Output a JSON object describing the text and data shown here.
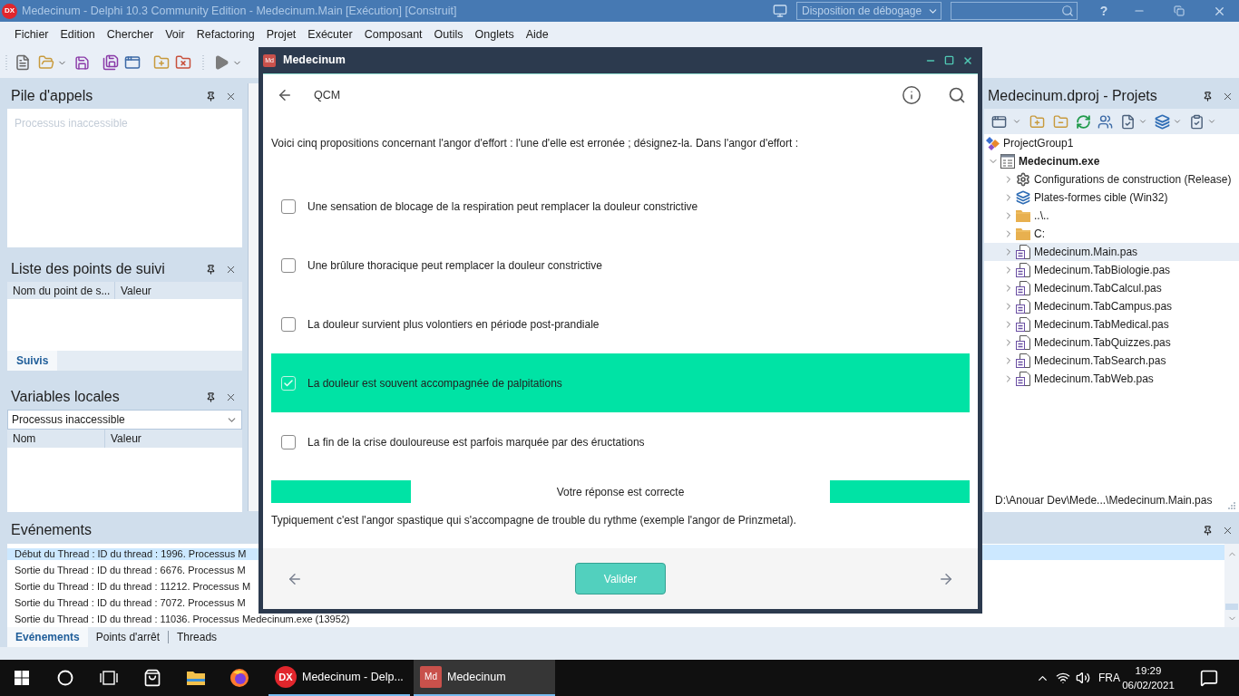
{
  "ide": {
    "logo": "DX",
    "title": "Medecinum - Delphi 10.3 Community Edition - Medecinum.Main [Exécution] [Construit]",
    "layout_dropdown": "Disposition de débogage",
    "help": "?",
    "menu": [
      "Fichier",
      "Edition",
      "Chercher",
      "Voir",
      "Refactoring",
      "Projet",
      "Exécuter",
      "Composant",
      "Outils",
      "Onglets",
      "Aide"
    ],
    "call_stack": {
      "title": "Pile d'appels",
      "message": "Processus inaccessible"
    },
    "watches": {
      "title": "Liste des points de suivi",
      "columns": [
        "Nom du point de s...",
        "Valeur"
      ],
      "tabs": [
        {
          "label": "Suivis",
          "selected": true
        }
      ]
    },
    "locals": {
      "title": "Variables locales",
      "dropdown": "Processus inaccessible",
      "columns": [
        "Nom",
        "Valeur"
      ]
    },
    "projects": {
      "title": "Medecinum.dproj - Projets",
      "tree": [
        {
          "label": "ProjectGroup1",
          "kind": "group",
          "selected": false,
          "children": [
            {
              "label": "Medecinum.exe",
              "kind": "project",
              "expanded": true,
              "selected": false,
              "children": [
                {
                  "label": "Configurations de construction (Release)",
                  "kind": "config",
                  "expanded": false,
                  "selected": false
                },
                {
                  "label": "Plates-formes cible (Win32)",
                  "kind": "platforms",
                  "expanded": false,
                  "selected": false
                },
                {
                  "label": "..\\..",
                  "kind": "folder",
                  "expanded": false,
                  "selected": false
                },
                {
                  "label": "C:",
                  "kind": "folder",
                  "expanded": false,
                  "selected": false
                },
                {
                  "label": "Medecinum.Main.pas",
                  "kind": "unit",
                  "expanded": false,
                  "selected": true
                },
                {
                  "label": "Medecinum.TabBiologie.pas",
                  "kind": "unit",
                  "expanded": false,
                  "selected": false
                },
                {
                  "label": "Medecinum.TabCalcul.pas",
                  "kind": "unit",
                  "expanded": false,
                  "selected": false
                },
                {
                  "label": "Medecinum.TabCampus.pas",
                  "kind": "unit",
                  "expanded": false,
                  "selected": false
                },
                {
                  "label": "Medecinum.TabMedical.pas",
                  "kind": "unit",
                  "expanded": false,
                  "selected": false
                },
                {
                  "label": "Medecinum.TabQuizzes.pas",
                  "kind": "unit",
                  "expanded": false,
                  "selected": false
                },
                {
                  "label": "Medecinum.TabSearch.pas",
                  "kind": "unit",
                  "expanded": false,
                  "selected": false
                },
                {
                  "label": "Medecinum.TabWeb.pas",
                  "kind": "unit",
                  "expanded": false,
                  "selected": false
                }
              ]
            }
          ]
        }
      ],
      "path": "D:\\Anouar Dev\\Mede...\\Medecinum.Main.pas"
    },
    "events": {
      "title": "Evénements",
      "rows": [
        {
          "text": "Début du Thread : ID du thread : 1996. Processus M",
          "selected": true
        },
        {
          "text": "Sortie du Thread : ID du thread : 6676. Processus M",
          "selected": false
        },
        {
          "text": "Sortie du Thread : ID du thread : 11212. Processus M",
          "selected": false
        },
        {
          "text": "Sortie du Thread : ID du thread : 7072. Processus M",
          "selected": false
        },
        {
          "text": "Sortie du Thread : ID du thread : 11036. Processus Medecinum.exe (13952)",
          "selected": false
        }
      ],
      "tabs": [
        {
          "label": "Evénements",
          "selected": true
        },
        {
          "label": "Points d'arrêt",
          "selected": false
        },
        {
          "label": "Threads",
          "selected": false
        }
      ]
    }
  },
  "app_window": {
    "icon": "Md",
    "title": "Medecinum",
    "header": "QCM",
    "question": "Voici cinq propositions concernant l'angor d'effort : l'une d'elle est erronée ; désignez-la. Dans l'angor d'effort :",
    "options": [
      {
        "text": "Une sensation de blocage de la respiration peut remplacer la douleur constrictive",
        "checked": false,
        "correct": false
      },
      {
        "text": "Une brûlure thoracique peut remplacer la douleur constrictive",
        "checked": false,
        "correct": false
      },
      {
        "text": "La douleur survient plus volontiers en période post-prandiale",
        "checked": false,
        "correct": false
      },
      {
        "text": "La douleur est souvent accompagnée de palpitations",
        "checked": true,
        "correct": true
      },
      {
        "text": "La fin de la crise douloureuse est parfois marquée par des éructations",
        "checked": false,
        "correct": false
      }
    ],
    "result": {
      "text": "Votre réponse est correcte",
      "correct": true
    },
    "explanation": "Typiquement c'est l'angor spastique qui s'accompagne de trouble du rythme (exemple l'angor de Prinzmetal).",
    "submit": "Valider"
  },
  "taskbar": {
    "apps": [
      {
        "kind": "delphi",
        "logo": "DX",
        "label": "Medecinum - Delp...",
        "active": false
      },
      {
        "kind": "medecinum",
        "logo": "Md",
        "label": "Medecinum",
        "active": true
      }
    ],
    "language": "FRA",
    "time": "19:29",
    "date": "06/02/2021"
  }
}
